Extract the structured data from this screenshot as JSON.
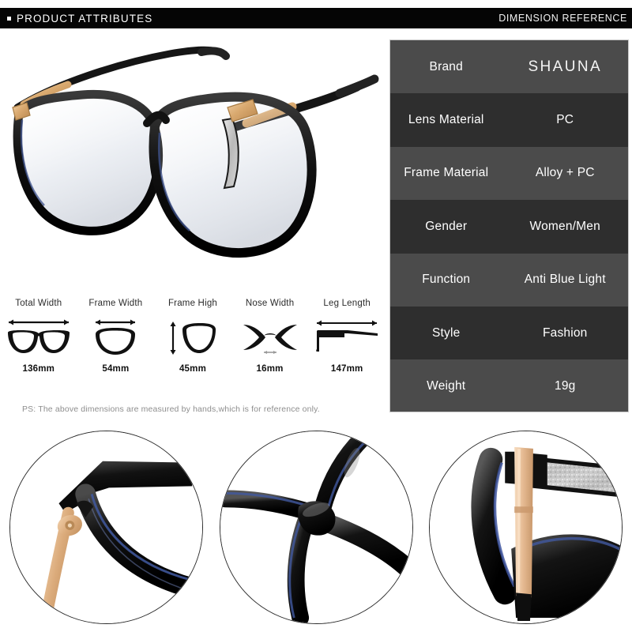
{
  "header": {
    "left_label": "PRODUCT ATTRIBUTES",
    "right_label": "DIMENSION REFERENCE",
    "bullet_icon": "square-bullet-icon",
    "bar_color": "#050505"
  },
  "product_photo": {
    "alt_name": "eyeglasses-three-quarter-view",
    "frame_color": "#1a1a1a",
    "accent_color": "#d9aa72"
  },
  "attributes": {
    "rows": [
      {
        "key": "Brand",
        "value": "SHAUNA",
        "style": "light",
        "is_brand": true
      },
      {
        "key": "Lens Material",
        "value": "PC",
        "style": "dark",
        "is_brand": false
      },
      {
        "key": "Frame Material",
        "value": "Alloy + PC",
        "style": "light",
        "is_brand": false
      },
      {
        "key": "Gender",
        "value": "Women/Men",
        "style": "dark",
        "is_brand": false
      },
      {
        "key": "Function",
        "value": "Anti Blue Light",
        "style": "light",
        "is_brand": false
      },
      {
        "key": "Style",
        "value": "Fashion",
        "style": "dark",
        "is_brand": false
      },
      {
        "key": "Weight",
        "value": "19g",
        "style": "light",
        "is_brand": false
      }
    ],
    "row_dark_color": "#2e2e2e",
    "row_light_color": "#4b4b4b",
    "border_color": "#c9c9c9"
  },
  "dimensions": {
    "items": [
      {
        "label": "Total Width",
        "value": "136mm",
        "icon": "full-glasses-front-icon"
      },
      {
        "label": "Frame Width",
        "value": "54mm",
        "icon": "single-lens-width-icon"
      },
      {
        "label": "Frame High",
        "value": "45mm",
        "icon": "single-lens-height-icon"
      },
      {
        "label": "Nose Width",
        "value": "16mm",
        "icon": "nose-bridge-icon"
      },
      {
        "label": "Leg Length",
        "value": "147mm",
        "icon": "temple-arm-icon"
      }
    ]
  },
  "footnote": {
    "text": "PS: The above dimensions are measured by hands,which is for reference only."
  },
  "detail_shots": [
    {
      "name": "hinge-and-temple-detail",
      "caption_icon": "hinge-closeup-icon"
    },
    {
      "name": "nose-bridge-detail",
      "caption_icon": "bridge-closeup-icon"
    },
    {
      "name": "gold-temple-glitter-detail",
      "caption_icon": "temple-closeup-icon"
    }
  ]
}
